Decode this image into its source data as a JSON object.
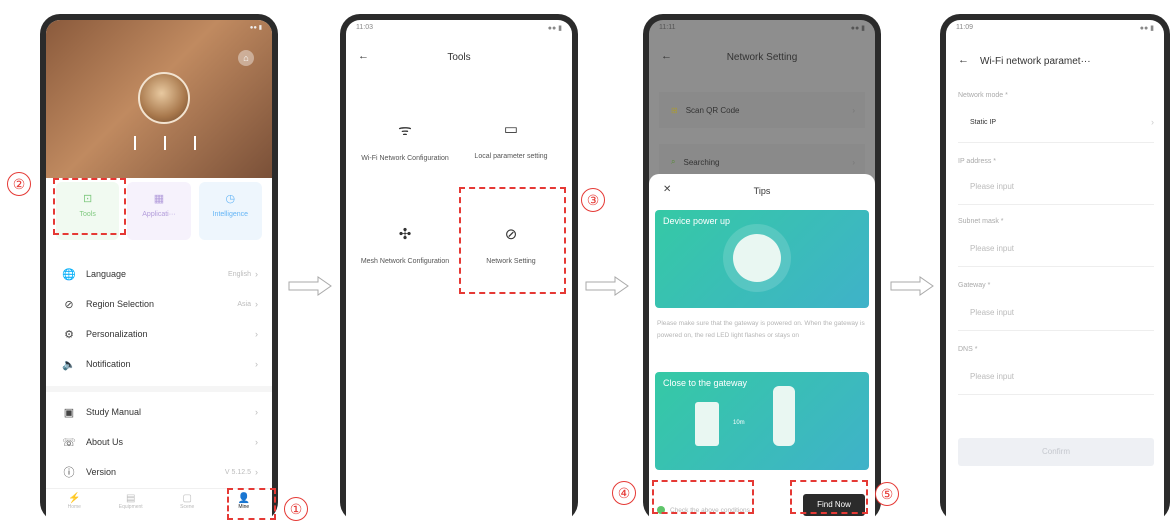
{
  "steps": [
    "①",
    "②",
    "③",
    "④",
    "⑤"
  ],
  "phone1": {
    "status_time": "",
    "tabs": [
      {
        "label": "Tools",
        "color": "#7fc97f"
      },
      {
        "label": "Applicati···",
        "color": "#b39ddb"
      },
      {
        "label": "Intelligence",
        "color": "#64b5f6"
      }
    ],
    "menu": [
      {
        "icon": "🌐",
        "label": "Language",
        "value": "English"
      },
      {
        "icon": "⊘",
        "label": "Region Selection",
        "value": "Asia"
      },
      {
        "icon": "⚙",
        "label": "Personalization",
        "value": ""
      },
      {
        "icon": "🔈",
        "label": "Notification",
        "value": ""
      },
      {
        "icon": "▣",
        "label": "Study Manual",
        "value": ""
      },
      {
        "icon": "☏",
        "label": "About Us",
        "value": ""
      },
      {
        "icon": "ⓘ",
        "label": "Version",
        "value": "V 5.12.5"
      }
    ],
    "bottom_nav": [
      {
        "icon": "⚡",
        "label": "Home"
      },
      {
        "icon": "▤",
        "label": "Equipment"
      },
      {
        "icon": "▢",
        "label": "Scene"
      },
      {
        "icon": "👤",
        "label": "Mine"
      }
    ]
  },
  "phone2": {
    "back": "←",
    "title": "Tools",
    "items": [
      {
        "icon": "ᯤ",
        "label": "Wi-Fi Network Configuration"
      },
      {
        "icon": "▭",
        "label": "Local parameter setting"
      },
      {
        "icon": "✣",
        "label": "Mesh Network Configuration"
      },
      {
        "icon": "⊘",
        "label": "Network Setting"
      }
    ]
  },
  "phone3": {
    "back": "←",
    "title": "Network Setting",
    "menu": [
      {
        "icon": "⊞",
        "label": "Scan QR Code"
      },
      {
        "icon": "⌕",
        "label": "Searching"
      }
    ],
    "tips_title": "Tips",
    "close": "✕",
    "card1_title": "Device power up",
    "tip_text": "Please make sure that the gateway is powered on. When the gateway is powered on, the red LED light flashes or stays on",
    "card2_title": "Close to the gateway",
    "card2_dist": "10m",
    "check_label": "Check the above conditions",
    "find_button": "Find Now"
  },
  "phone4": {
    "back": "←",
    "title": "Wi-Fi network paramet···",
    "fields": [
      {
        "label": "Network mode *",
        "value": "Static IP"
      },
      {
        "label": "IP address *",
        "value": "Please input"
      },
      {
        "label": "Subnet mask *",
        "value": "Please input"
      },
      {
        "label": "Gateway *",
        "value": "Please input"
      },
      {
        "label": "DNS *",
        "value": "Please input"
      }
    ],
    "confirm": "Confirm"
  }
}
